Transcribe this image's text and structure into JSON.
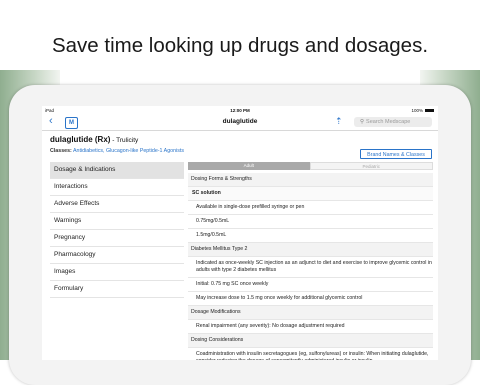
{
  "headline": "Save time looking up drugs and dosages.",
  "status_bar": {
    "carrier": "iPad",
    "time": "12:00 PM",
    "battery": "100%"
  },
  "nav": {
    "title": "dulaglutide",
    "app_logo": "M",
    "search_placeholder": "Search Medscape"
  },
  "drug": {
    "name": "dulaglutide (Rx)",
    "brand_sep": " - ",
    "brand": "Trulicity",
    "classes_label": "Classes:",
    "classes_value": "Antidiabetics, Glucagon-like Peptide-1 Agonists",
    "brand_button": "Brand Names & Classes"
  },
  "sidebar": {
    "items": [
      {
        "label": "Dosage & Indications"
      },
      {
        "label": "Interactions"
      },
      {
        "label": "Adverse Effects"
      },
      {
        "label": "Warnings"
      },
      {
        "label": "Pregnancy"
      },
      {
        "label": "Pharmacology"
      },
      {
        "label": "Images"
      },
      {
        "label": "Formulary"
      }
    ]
  },
  "tabs": {
    "adult": "Adult",
    "pediatric": "Pediatric"
  },
  "content": {
    "dosing_header": "Dosing Forms & Strengths",
    "sc_solution": "SC solution",
    "form": "Available in single-dose prefilled syringe or pen",
    "strength1": "0.75mg/0.5mL",
    "strength2": "1.5mg/0.5mL",
    "dm_header": "Diabetes Mellitus Type 2",
    "indication": "Indicated as once-weekly SC injection as an adjunct to diet and exercise to improve glycemic control in adults with type 2 diabetes mellitus",
    "initial": "Initial: 0.75 mg SC once weekly",
    "increase": "May increase dose to 1.5 mg once weekly for additional glycemic control",
    "modifications_header": "Dosage Modifications",
    "renal": "Renal impairment (any severity): No dosage adjustment required",
    "considerations_header": "Dosing Considerations",
    "coadmin": "Coadministration with insulin secretagogues (eg, sulfonylureas) or insulin: When initiating dulaglutide, consider reducing the dosage of concomitantly administered insulin or insulin"
  }
}
